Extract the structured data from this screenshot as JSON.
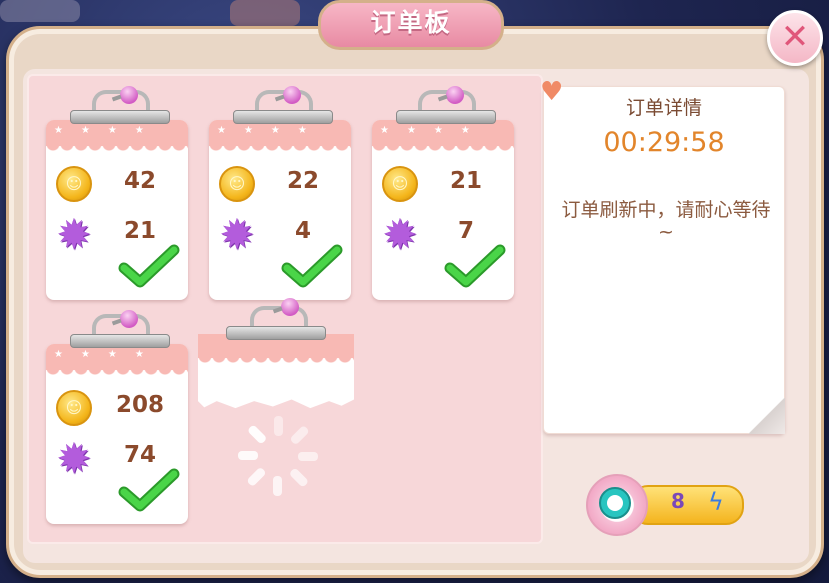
{
  "title": "订单板",
  "close_glyph": "✕",
  "orders": [
    {
      "coins": "42",
      "gems": "21",
      "done": true
    },
    {
      "coins": "22",
      "gems": "4",
      "done": true
    },
    {
      "coins": "21",
      "gems": "7",
      "done": true
    },
    {
      "coins": "208",
      "gems": "74",
      "done": true
    }
  ],
  "detail": {
    "title": "订单详情",
    "timer": "00:29:58",
    "message": "订单刷新中，请耐心等待~"
  },
  "speedup": {
    "count": "8"
  },
  "icons": {
    "coin": "coin-icon",
    "gem": "star-gem-icon",
    "check": "green-check-icon",
    "close": "close-icon",
    "pin": "pushpin-icon",
    "loading": "loading-spinner-icon",
    "stopwatch": "stopwatch-icon",
    "bolt": "lightning-icon",
    "heart": "heart-icon"
  },
  "colors": {
    "accent_pink": "#f8b9b4",
    "panel_bg": "#f7d7d9",
    "timer": "#e2852b",
    "value_text": "#8b4a2c",
    "check_green": "#3fc83d"
  }
}
